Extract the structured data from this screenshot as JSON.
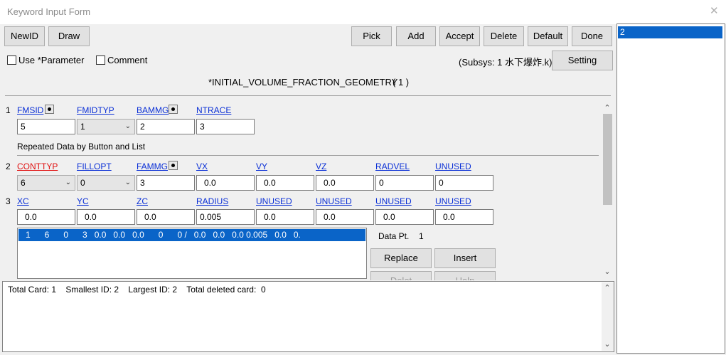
{
  "window": {
    "title": "Keyword Input Form",
    "close_glyph": "✕"
  },
  "toolbar": {
    "newid": "NewID",
    "draw": "Draw",
    "pick": "Pick",
    "add": "Add",
    "accept": "Accept",
    "delete": "Delete",
    "default": "Default",
    "done": "Done"
  },
  "options": {
    "use_parameter": "Use *Parameter",
    "use_parameter_checked": false,
    "comment": "Comment",
    "comment_checked": false,
    "subsys": "(Subsys: 1 水下爆炸.k)",
    "setting": "Setting"
  },
  "keyword": {
    "title": "*INITIAL_VOLUME_FRACTION_GEOMETRY",
    "count": "( 1 )"
  },
  "card1": {
    "row": "1",
    "fields": [
      {
        "label": "FMSID",
        "value": "5"
      },
      {
        "label": "FMIDTYP",
        "value": "1"
      },
      {
        "label": "BAMMG",
        "value": "2"
      },
      {
        "label": "NTRACE",
        "value": "3"
      }
    ]
  },
  "repeated_header": "Repeated Data by Button and List",
  "card2": {
    "row": "2",
    "fields": [
      {
        "label": "CONTTYP",
        "value": "6"
      },
      {
        "label": "FILLOPT",
        "value": "0"
      },
      {
        "label": "FAMMG",
        "value": "3"
      },
      {
        "label": "VX",
        "value": "0.0"
      },
      {
        "label": "VY",
        "value": "0.0"
      },
      {
        "label": "VZ",
        "value": "0.0"
      },
      {
        "label": "RADVEL",
        "value": "0"
      },
      {
        "label": "UNUSED",
        "value": "0"
      }
    ]
  },
  "card3": {
    "row": "3",
    "fields": [
      {
        "label": "XC",
        "value": "0.0"
      },
      {
        "label": "YC",
        "value": "0.0"
      },
      {
        "label": "ZC",
        "value": "0.0"
      },
      {
        "label": "RADIUS",
        "value": "0.005"
      },
      {
        "label": "UNUSED",
        "value": "0.0"
      },
      {
        "label": "UNUSED",
        "value": "0.0"
      },
      {
        "label": "UNUSED",
        "value": "0.0"
      },
      {
        "label": "UNUSED",
        "value": "0.0"
      }
    ]
  },
  "data_list": {
    "rows": [
      "1      6      0      3   0.0   0.0   0.0      0      0 /   0.0   0.0   0.0 0.005   0.0   0."
    ],
    "data_pt_label": "Data Pt.",
    "data_pt_value": "1",
    "replace": "Replace",
    "insert": "Insert",
    "delete_partial": "Delet",
    "help_partial": "Help"
  },
  "status": {
    "text": "Total Card: 1    Smallest ID: 2    Largest ID: 2    Total deleted card:  0"
  },
  "id_list": {
    "items": [
      "2"
    ]
  },
  "colors": {
    "selection": "#0a64c8",
    "link": "#0a2fd6",
    "required_link": "#e01010"
  },
  "icons": [
    "close-icon",
    "chevron-down-icon",
    "scroll-up-icon",
    "scroll-down-icon",
    "pick-dot-icon"
  ]
}
